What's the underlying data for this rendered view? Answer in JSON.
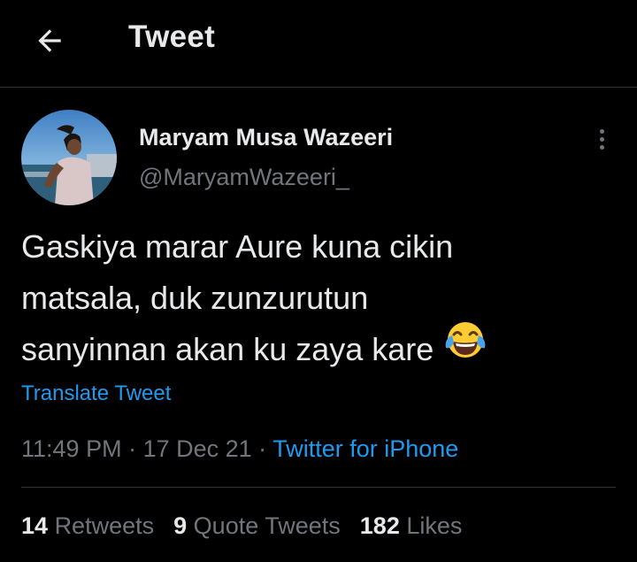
{
  "header": {
    "title": "Tweet",
    "back_icon": "arrow-left-icon"
  },
  "author": {
    "name": "Maryam Musa Wazeeri",
    "handle": "@MaryamWazeeri_",
    "avatar": "profile-photo"
  },
  "tweet": {
    "lines": [
      "Gaskiya marar Aure kuna cikin",
      "matsala, duk zunzurutun",
      "sanyinnan akan ku zaya kare"
    ],
    "emoji": "face-with-tears-of-joy-icon",
    "translate_label": "Translate Tweet"
  },
  "meta": {
    "time": "11:49 PM",
    "sep1": " · ",
    "date": "17 Dec 21",
    "sep2": " · ",
    "source": "Twitter for iPhone"
  },
  "stats": {
    "retweets": {
      "count": "14",
      "label": "Retweets"
    },
    "quotes": {
      "count": "9",
      "label": "Quote Tweets"
    },
    "likes": {
      "count": "182",
      "label": "Likes"
    }
  },
  "colors": {
    "background": "#000000",
    "text": "#e7e9ea",
    "secondary": "#71767b",
    "accent": "#1d9bf0",
    "divider": "#2f3336"
  }
}
